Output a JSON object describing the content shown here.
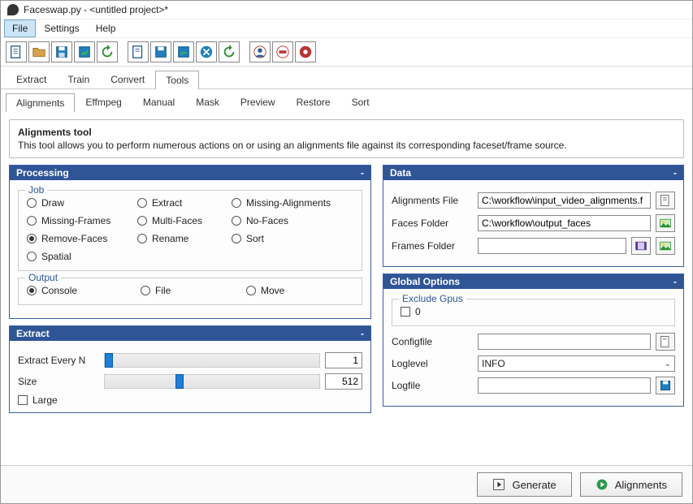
{
  "window": {
    "title": "Faceswap.py - <untitled project>*"
  },
  "menu": {
    "items": [
      "File",
      "Settings",
      "Help"
    ],
    "active": 0
  },
  "main_tabs": {
    "items": [
      "Extract",
      "Train",
      "Convert",
      "Tools"
    ],
    "active": 3
  },
  "sub_tabs": {
    "items": [
      "Alignments",
      "Effmpeg",
      "Manual",
      "Mask",
      "Preview",
      "Restore",
      "Sort"
    ],
    "active": 0
  },
  "description": {
    "title": "Alignments tool",
    "body": "This tool allows you to perform numerous actions on or using an alignments file against its corresponding faceset/frame source."
  },
  "processing": {
    "title": "Processing",
    "job_legend": "Job",
    "jobs": [
      "Draw",
      "Extract",
      "Missing-Alignments",
      "Missing-Frames",
      "Multi-Faces",
      "No-Faces",
      "Remove-Faces",
      "Rename",
      "Sort",
      "Spatial"
    ],
    "job_selected": "Remove-Faces",
    "output_legend": "Output",
    "outputs": [
      "Console",
      "File",
      "Move"
    ],
    "output_selected": "Console"
  },
  "extract": {
    "title": "Extract",
    "every_n_label": "Extract Every N",
    "every_n_value": "1",
    "size_label": "Size",
    "size_value": "512",
    "large_label": "Large",
    "large_checked": false
  },
  "data": {
    "title": "Data",
    "alignments_label": "Alignments File",
    "alignments_value": "C:\\workflow\\input_video_alignments.f",
    "faces_label": "Faces Folder",
    "faces_value": "C:\\workflow\\output_faces",
    "frames_label": "Frames Folder",
    "frames_value": ""
  },
  "global": {
    "title": "Global Options",
    "exclude_legend": "Exclude Gpus",
    "gpu0_label": "0",
    "gpu0_checked": false,
    "configfile_label": "Configfile",
    "configfile_value": "",
    "loglevel_label": "Loglevel",
    "loglevel_value": "INFO",
    "logfile_label": "Logfile",
    "logfile_value": ""
  },
  "buttons": {
    "generate": "Generate",
    "alignments": "Alignments"
  }
}
